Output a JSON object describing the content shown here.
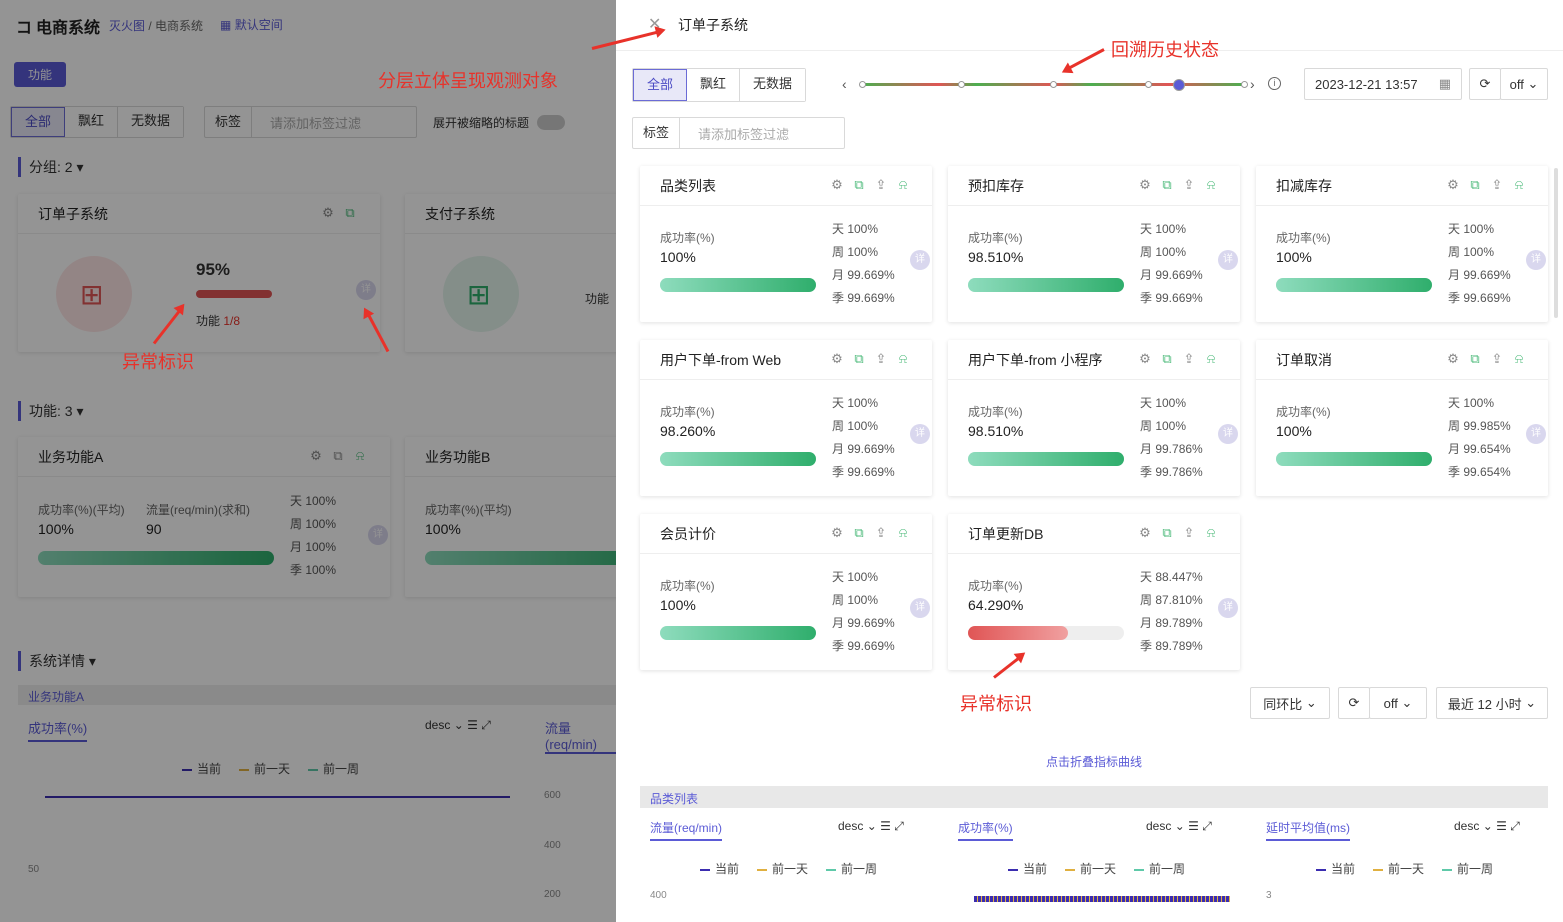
{
  "bg": {
    "app_title": "电商系统",
    "breadcrumb_link": "灭火图",
    "breadcrumb_sep": "/",
    "breadcrumb_current": "电商系统",
    "workspace": "默认空间",
    "func_tag": "功能",
    "filter_tabs": [
      "全部",
      "飘红",
      "无数据"
    ],
    "tag_label": "标签",
    "tag_placeholder": "请添加标签过滤",
    "expand_label": "展开被缩略的标题",
    "group_header": "分组: 2",
    "group_cards": [
      {
        "title": "订单子系统",
        "pct": "95%",
        "func_label": "功能",
        "func_value": "1/8"
      },
      {
        "title": "支付子系统",
        "func_label": "功能"
      }
    ],
    "func_header": "功能: 3",
    "func_cards": [
      {
        "title": "业务功能A",
        "m1_label": "成功率(%)(平均)",
        "m1_value": "100%",
        "m2_label": "流量(req/min)(求和)",
        "m2_value": "90",
        "periods": [
          "天 100%",
          "周 100%",
          "月 100%",
          "季 100%"
        ]
      },
      {
        "title": "业务功能B",
        "m1_label": "成功率(%)(平均)",
        "m1_value": "100%"
      }
    ],
    "detail_header": "系统详情",
    "detail_bar": "业务功能A",
    "chart_a_title": "成功率(%)",
    "chart_b_title": "流量(req/min)",
    "sort": "desc",
    "legend": [
      "当前",
      "前一天",
      "前一周"
    ],
    "ticks_a": [
      "50"
    ],
    "ticks_b": [
      "600",
      "400",
      "200"
    ]
  },
  "panel": {
    "title": "订单子系统",
    "filter_tabs": [
      "全部",
      "飘红",
      "无数据"
    ],
    "datetime": "2023-12-21 13:57",
    "refresh_mode": "off",
    "tag_label": "标签",
    "tag_placeholder": "请添加标签过滤",
    "timeline_points": 6,
    "timeline_selected_index": 4,
    "cards": [
      {
        "title": "品类列表",
        "label": "成功率(%)",
        "value": "100%",
        "fill": 1.0,
        "bad": false,
        "periods": [
          "天 100%",
          "周 100%",
          "月 99.669%",
          "季 99.669%"
        ]
      },
      {
        "title": "预扣库存",
        "label": "成功率(%)",
        "value": "98.510%",
        "fill": 1.0,
        "bad": false,
        "periods": [
          "天 100%",
          "周 100%",
          "月 99.669%",
          "季 99.669%"
        ]
      },
      {
        "title": "扣减库存",
        "label": "成功率(%)",
        "value": "100%",
        "fill": 1.0,
        "bad": false,
        "periods": [
          "天 100%",
          "周 100%",
          "月 99.669%",
          "季 99.669%"
        ]
      },
      {
        "title": "用户下单-from Web",
        "label": "成功率(%)",
        "value": "98.260%",
        "fill": 1.0,
        "bad": false,
        "periods": [
          "天 100%",
          "周 100%",
          "月 99.669%",
          "季 99.669%"
        ]
      },
      {
        "title": "用户下单-from 小程序",
        "label": "成功率(%)",
        "value": "98.510%",
        "fill": 1.0,
        "bad": false,
        "periods": [
          "天 100%",
          "周 100%",
          "月 99.786%",
          "季 99.786%"
        ]
      },
      {
        "title": "订单取消",
        "label": "成功率(%)",
        "value": "100%",
        "fill": 1.0,
        "bad": false,
        "periods": [
          "天 100%",
          "周 99.985%",
          "月 99.654%",
          "季 99.654%"
        ]
      },
      {
        "title": "会员计价",
        "label": "成功率(%)",
        "value": "100%",
        "fill": 1.0,
        "bad": false,
        "periods": [
          "天 100%",
          "周 100%",
          "月 99.669%",
          "季 99.669%"
        ]
      },
      {
        "title": "订单更新DB",
        "label": "成功率(%)",
        "value": "64.290%",
        "fill": 0.6429,
        "bad": true,
        "periods": [
          "天 88.447%",
          "周 87.810%",
          "月 89.789%",
          "季 89.789%"
        ]
      }
    ],
    "detail_label": "详",
    "compare": "同环比",
    "refresh2": "off",
    "range": "最近 12 小时",
    "collapse_link": "点击折叠指标曲线",
    "detail_bar": "品类列表",
    "charts": [
      {
        "title": "流量(req/min)",
        "sort": "desc",
        "tick": "400"
      },
      {
        "title": "成功率(%)",
        "sort": "desc",
        "tick": ""
      },
      {
        "title": "延时平均值(ms)",
        "sort": "desc",
        "tick": "3"
      }
    ],
    "legend": [
      "当前",
      "前一天",
      "前一周"
    ]
  },
  "annotations": {
    "layered": "分层立体呈现观测对象",
    "history": "回溯历史状态",
    "abnormal_left": "异常标识",
    "abnormal_right": "异常标识"
  },
  "colors": {
    "accent": "#5b5bd6",
    "good": "#2fae6c",
    "bad": "#e05555",
    "anno": "#e8322a"
  }
}
